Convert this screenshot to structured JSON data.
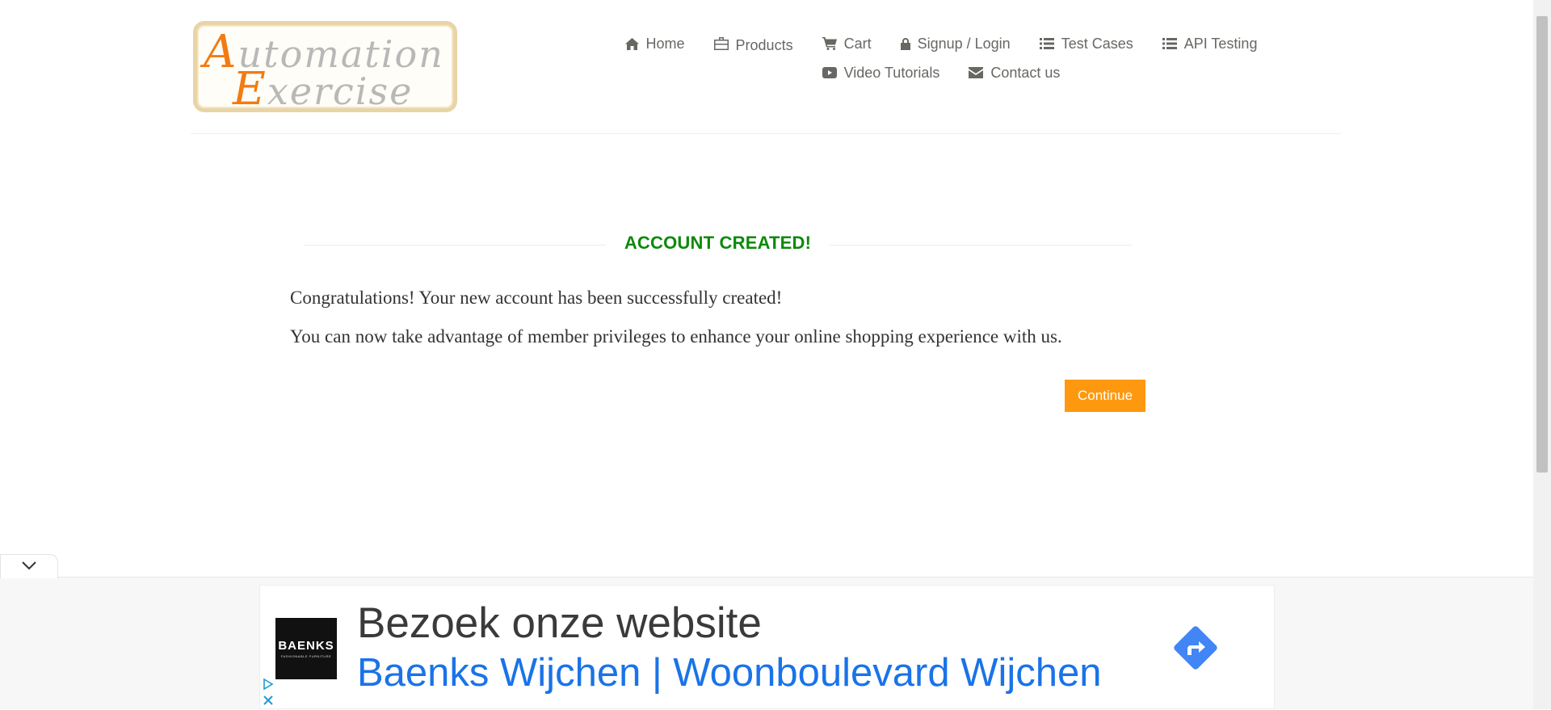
{
  "header": {
    "logo": {
      "line1_cap": "A",
      "line1_rest": "utomation",
      "line2_cap": "E",
      "line2_rest": "xercise"
    },
    "nav": [
      {
        "label": "Home",
        "icon": "home-icon"
      },
      {
        "label": "Products",
        "icon": "briefcase-icon"
      },
      {
        "label": "Cart",
        "icon": "cart-icon"
      },
      {
        "label": "Signup / Login",
        "icon": "lock-icon"
      },
      {
        "label": "Test Cases",
        "icon": "list-icon"
      },
      {
        "label": "API Testing",
        "icon": "list-icon"
      },
      {
        "label": "Video Tutorials",
        "icon": "youtube-icon"
      },
      {
        "label": "Contact us",
        "icon": "envelope-icon"
      }
    ]
  },
  "main": {
    "title": "ACCOUNT CREATED!",
    "message1": "Congratulations! Your new account has been successfully created!",
    "message2": "You can now take advantage of member privileges to enhance your online shopping experience with us.",
    "continue_label": "Continue"
  },
  "ad": {
    "logo_text": "BAENKS",
    "logo_subtext": "FASHIONABLE FURNITURE",
    "headline": "Bezoek onze website",
    "subline": "Baenks Wijchen | Woonboulevard Wijchen",
    "cta_icon": "directions-arrow-icon",
    "toggle_icon": "chevron-down-icon"
  },
  "colors": {
    "title_green": "#0b8a0b",
    "button_orange": "#fe980f",
    "nav_text": "#696763",
    "ad_link_blue": "#1a73e8",
    "logo_orange": "#f27b13"
  }
}
